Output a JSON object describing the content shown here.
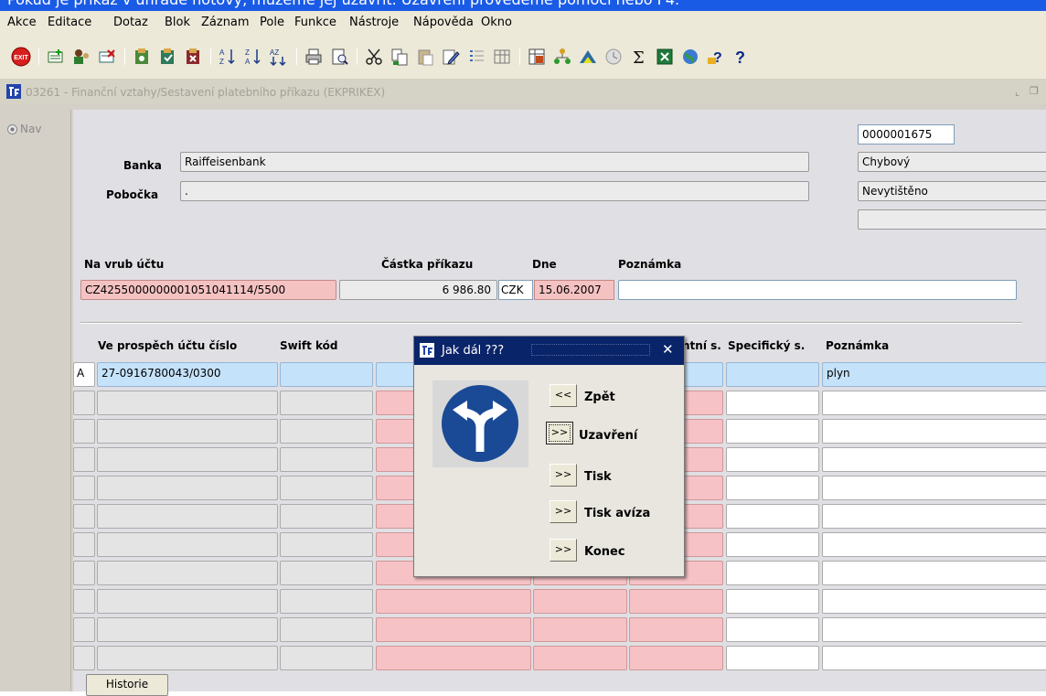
{
  "top_strip": {
    "text": "Pokud je příkaz v úhrade hotový, můžeme jej uzavřít. Uzavření provedeme pomocí nebo F4."
  },
  "menu": [
    "Akce",
    "Editace",
    "Dotaz",
    "Blok",
    "Záznam",
    "Pole",
    "Funkce",
    "Nástroje",
    "Nápověda",
    "Okno"
  ],
  "toolbar": {
    "exit_label": "EXIT",
    "sum_glyph": "Σ",
    "help_glyph": "?"
  },
  "window": {
    "title": "03261 - Finanční vztahy/Sestavení platebního příkazu (EKPRIKEX)",
    "nav_label": "Nav"
  },
  "form": {
    "bank_label": "Banka",
    "bank_value": "Raiffeisenbank",
    "branch_label": "Pobočka",
    "branch_value": ".",
    "doc_number": "0000001675",
    "status1": "Chybový",
    "status2": "Nevytištěno",
    "status3": "",
    "debit_label": "Na vrub účtu",
    "debit_value": "CZ4255000000001051041114/5500",
    "amount_label": "Částka příkazu",
    "amount_value": "6 986.80",
    "currency_value": "CZK",
    "date_label": "Dne",
    "date_value": "15.06.2007",
    "note_label": "Poznámka",
    "note_value": ""
  },
  "grid": {
    "headers": {
      "account": "Ve prospěch účtu číslo",
      "swift": "Swift kód",
      "const": "ntní s.",
      "specific": "Specifický s.",
      "note": "Poznámka"
    },
    "rows": [
      {
        "flag": "A",
        "account": "27-0916780043/0300",
        "note": "plyn"
      },
      {
        "flag": "",
        "account": "",
        "note": ""
      },
      {
        "flag": "",
        "account": "",
        "note": ""
      },
      {
        "flag": "",
        "account": "",
        "note": ""
      },
      {
        "flag": "",
        "account": "",
        "note": ""
      },
      {
        "flag": "",
        "account": "",
        "note": ""
      },
      {
        "flag": "",
        "account": "",
        "note": ""
      },
      {
        "flag": "",
        "account": "",
        "note": ""
      },
      {
        "flag": "",
        "account": "",
        "note": ""
      },
      {
        "flag": "",
        "account": "",
        "note": ""
      },
      {
        "flag": "",
        "account": "",
        "note": ""
      }
    ],
    "history_button": "Historie"
  },
  "dialog": {
    "title": "Jak dál ???",
    "buttons": [
      {
        "glyph": "<<",
        "label": "Zpět"
      },
      {
        "glyph": ">>",
        "label": "Uzavření"
      },
      {
        "glyph": ">>",
        "label": "Tisk"
      },
      {
        "glyph": ">>",
        "label": "Tisk avíza"
      },
      {
        "glyph": ">>",
        "label": "Konec"
      }
    ],
    "sign_icon": "turn-left-or-right-sign-icon"
  },
  "colors": {
    "dialog_title_bg": "#0a246a",
    "required_field": "#f6c2c5",
    "current_row": "#c5e2fb",
    "app_icon": "#2244aa"
  }
}
